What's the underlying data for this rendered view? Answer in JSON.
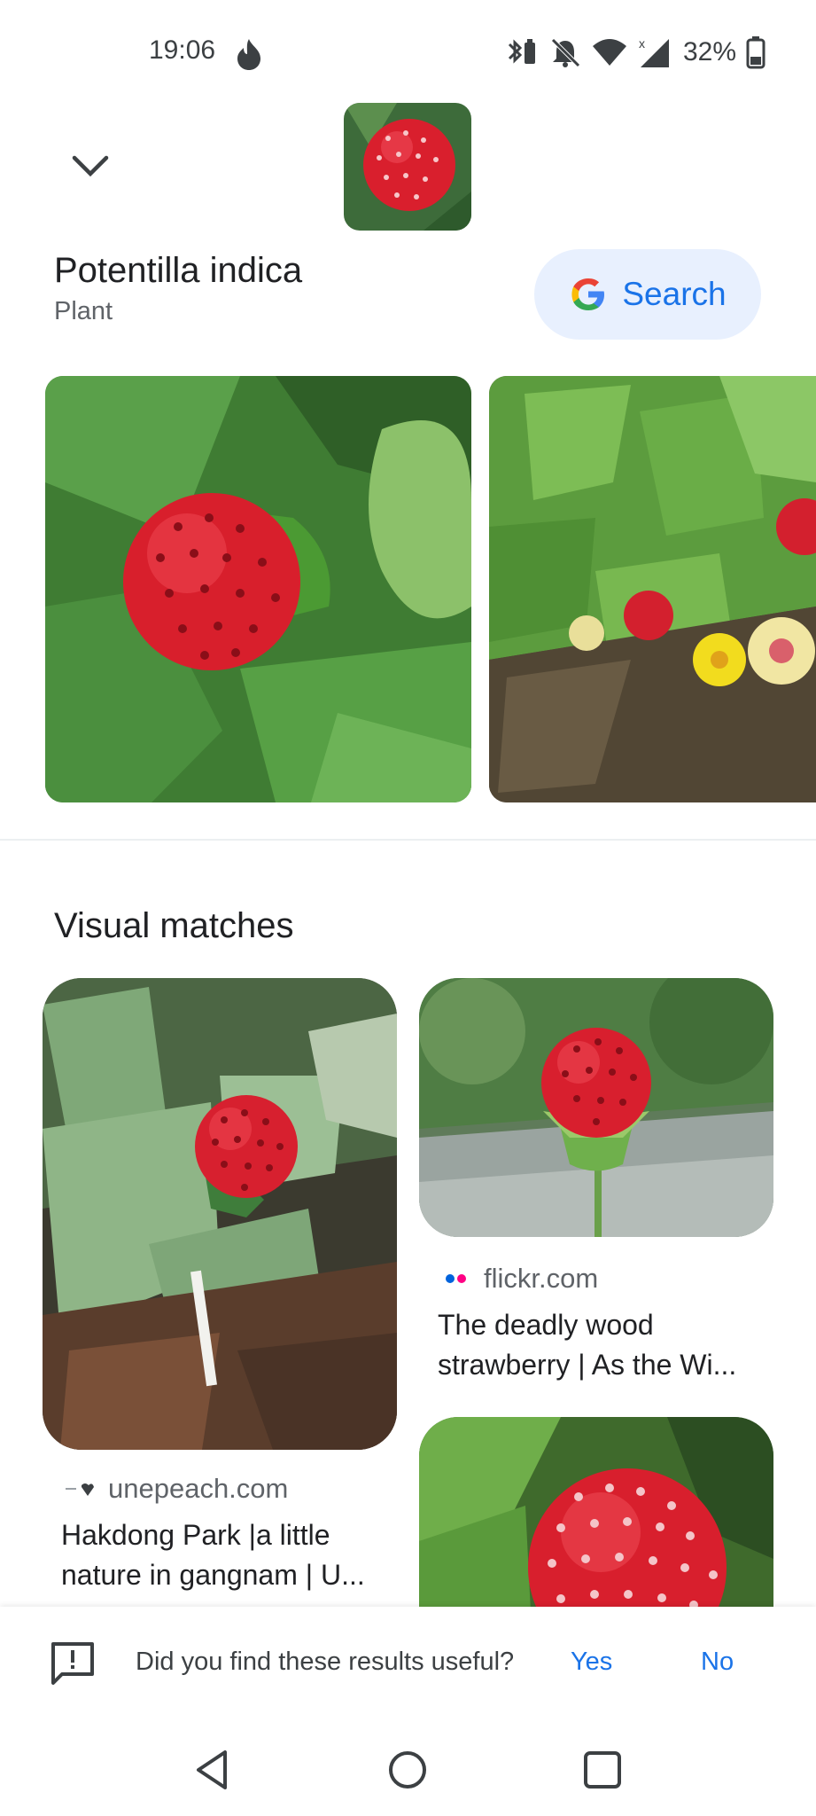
{
  "status_bar": {
    "time": "19:06",
    "battery": "32%",
    "icons": [
      "flame-icon",
      "bluetooth-battery-icon",
      "bell-off-icon",
      "wifi-icon",
      "signal-icon",
      "battery-icon"
    ]
  },
  "header": {
    "title": "Potentilla indica",
    "subtitle": "Plant",
    "search_label": "Search"
  },
  "visual_matches": {
    "title": "Visual matches",
    "cards": [
      {
        "source": "unepeach.com",
        "title": "Hakdong Park |a little nature in gangnam | U..."
      },
      {
        "source": "flickr.com",
        "title": "The deadly wood strawberry | As the Wi..."
      }
    ]
  },
  "feedback": {
    "question": "Did you find these results useful?",
    "yes": "Yes",
    "no": "No"
  },
  "colors": {
    "accent": "#1a73e8",
    "search_bg": "#e8f0fe",
    "berry_red": "#e0222e",
    "leaf_green": "#4f9a3a"
  }
}
